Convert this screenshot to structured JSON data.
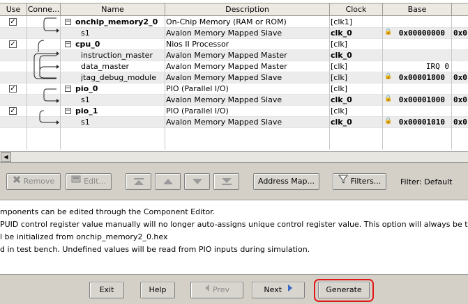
{
  "columns": {
    "use": "Use",
    "connections": "Conne...",
    "name": "Name",
    "description": "Description",
    "clock": "Clock",
    "base": "Base",
    "end": ""
  },
  "rows": [
    {
      "checked": true,
      "toggle": "⊟",
      "name": "onchip_memory2_0",
      "bold": true,
      "description": "On-Chip Memory (RAM or ROM)",
      "clock": "[clk1]",
      "clock_bold": false,
      "base": "",
      "end": ""
    },
    {
      "checked": false,
      "toggle": "",
      "name": "s1",
      "bold": false,
      "description": "Avalon Memory Mapped Slave",
      "clock": "clk_0",
      "clock_bold": true,
      "base": "0x00000000",
      "end": "0x0"
    },
    {
      "checked": true,
      "toggle": "⊟",
      "name": "cpu_0",
      "bold": true,
      "description": "Nios II Processor",
      "clock": "[clk]",
      "clock_bold": false,
      "base": "",
      "end": ""
    },
    {
      "checked": false,
      "toggle": "",
      "name": "instruction_master",
      "bold": false,
      "description": "Avalon Memory Mapped Master",
      "clock": "clk_0",
      "clock_bold": true,
      "base": "",
      "end": ""
    },
    {
      "checked": false,
      "toggle": "",
      "name": "data_master",
      "bold": false,
      "description": "Avalon Memory Mapped Master",
      "clock": "[clk]",
      "clock_bold": false,
      "base": "IRQ 0",
      "end": ""
    },
    {
      "checked": false,
      "toggle": "",
      "name": "jtag_debug_module",
      "bold": false,
      "description": "Avalon Memory Mapped Slave",
      "clock": "[clk]",
      "clock_bold": false,
      "base": "0x00001800",
      "end": "0x0"
    },
    {
      "checked": true,
      "toggle": "⊟",
      "name": "pio_0",
      "bold": true,
      "description": "PIO (Parallel I/O)",
      "clock": "[clk]",
      "clock_bold": false,
      "base": "",
      "end": ""
    },
    {
      "checked": false,
      "toggle": "",
      "name": "s1",
      "bold": false,
      "description": "Avalon Memory Mapped Slave",
      "clock": "clk_0",
      "clock_bold": true,
      "base": "0x00001000",
      "end": "0x0"
    },
    {
      "checked": true,
      "toggle": "⊟",
      "name": "pio_1",
      "bold": true,
      "description": "PIO (Parallel I/O)",
      "clock": "[clk]",
      "clock_bold": false,
      "base": "",
      "end": ""
    },
    {
      "checked": false,
      "toggle": "",
      "name": "s1",
      "bold": false,
      "description": "Avalon Memory Mapped Slave",
      "clock": "clk_0",
      "clock_bold": true,
      "base": "0x00001010",
      "end": "0x0"
    }
  ],
  "toolbar": {
    "remove": "Remove",
    "edit": "Edit...",
    "address_map": "Address Map...",
    "filters": "Filters...",
    "filter_status": "Filter: Default"
  },
  "messages": [
    "mponents can be edited through the Component Editor.",
    "PUID control register value manually will no longer auto-assigns unique control register value. This option will always be turned on with defa",
    "l be initialized from onchip_memory2_0.hex",
    "d in test bench. Undefined values will be read from PIO inputs during simulation."
  ],
  "bottom": {
    "exit": "Exit",
    "help": "Help",
    "prev": "Prev",
    "next": "Next",
    "generate": "Generate"
  },
  "colors": {
    "highlight": "#e01818",
    "arrow": "#3a66c4"
  }
}
